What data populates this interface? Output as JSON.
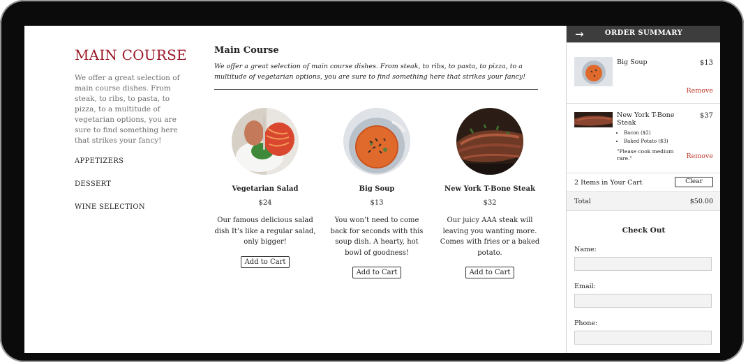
{
  "sidebar": {
    "heading": "MAIN COURSE",
    "description": "We offer a great selection of main course dishes. From steak, to ribs, to pasta, to pizza, to a multitude of vegetarian options, you are sure to find something here that strikes your fancy!",
    "nav": [
      "APPETIZERS",
      "DESSERT",
      "WINE SELECTION"
    ]
  },
  "main": {
    "title": "Main Course",
    "intro": "We offer a great selection of main course dishes. From steak, to ribs, to pasta, to pizza, to a multitude of vegetarian options, you are sure to find something here that strikes your fancy!",
    "dishes": [
      {
        "name": "Vegetarian Salad",
        "price": "$24",
        "description": "Our famous delicious salad dish It’s like a regular salad, only bigger!",
        "button": "Add to Cart"
      },
      {
        "name": "Big Soup",
        "price": "$13",
        "description": "You won’t need to come back for seconds with this soup dish. A hearty, hot bowl of goodness!",
        "button": "Add to Cart"
      },
      {
        "name": "New York T-Bone Steak",
        "price": "$32",
        "description": "Our juicy AAA steak will leaving you wanting more. Comes with fries or a baked potato.",
        "button": "Add to Cart"
      }
    ]
  },
  "summary": {
    "title": "ORDER SUMMARY",
    "arrow_icon": "arrow-right-icon",
    "items": [
      {
        "name": "Big Soup",
        "price": "$13",
        "remove": "Remove"
      },
      {
        "name": "New York T-Bone Steak",
        "price": "$37",
        "options": [
          "Bacon ($2)",
          "Baked Potato ($3)"
        ],
        "note": "\"Please cook medium rare.\"",
        "remove": "Remove"
      }
    ],
    "count_text": "2 Items in Your Cart",
    "clear_label": "Clear",
    "total_label": "Total",
    "total_value": "$50.00"
  },
  "checkout": {
    "title": "Check Out",
    "name_label": "Name:",
    "email_label": "Email:",
    "phone_label": "Phone:"
  },
  "colors": {
    "accent": "#9b1b2a",
    "remove": "#c0392b",
    "header": "#3d3d3d"
  }
}
